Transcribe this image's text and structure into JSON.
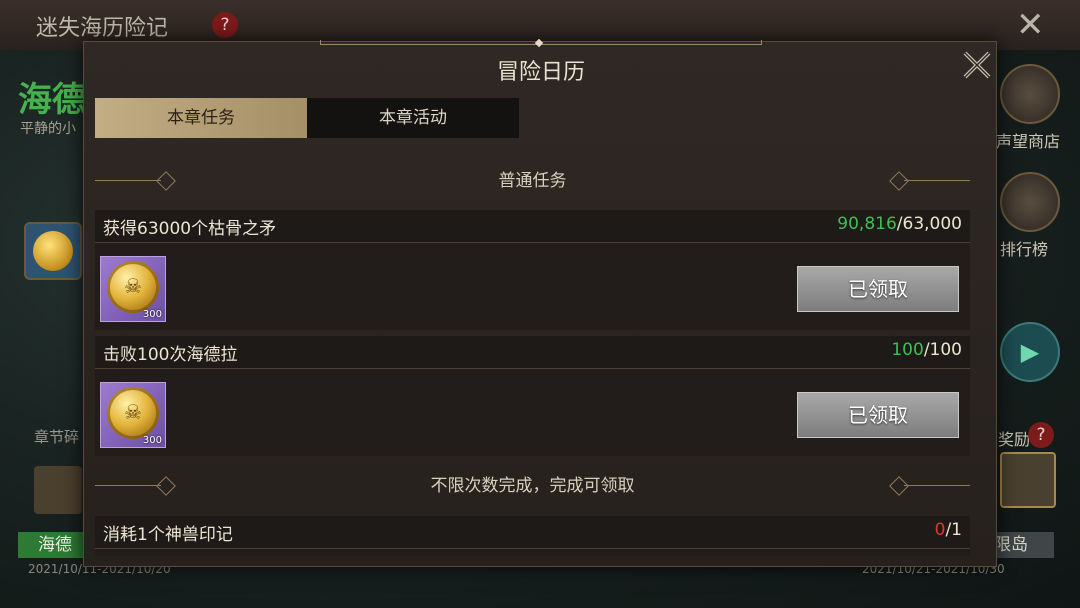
{
  "background": {
    "title": "迷失海历险记",
    "help_glyph": "?",
    "close_glyph": "✕",
    "hero_name": "海德",
    "hero_subtitle": "平静的小",
    "chapter_label": "章节碎",
    "green_bar_text": "海德",
    "date_left": "2021/10/11-2021/10/20",
    "date_right": "2021/10/21-2021/10/30",
    "side_shop_label": "声望商店",
    "side_rank_label": "排行榜",
    "reward_label": "奖励",
    "island_label": "限岛"
  },
  "dialog": {
    "title": "冒险日历",
    "close_icon": "close-icon"
  },
  "tabs": [
    {
      "label": "本章任务",
      "active": true
    },
    {
      "label": "本章活动",
      "active": false
    }
  ],
  "sections": {
    "normal": "普通任务",
    "unlimited": "不限次数完成，完成可领取"
  },
  "tasks": [
    {
      "name": "获得63000个枯骨之矛",
      "progress_current": "90,816",
      "progress_total": "/63,000",
      "reward_qty": "300",
      "reward_icon": "skull-gold-coin-icon",
      "button_label": "已领取"
    },
    {
      "name": "击败100次海德拉",
      "progress_current": "100",
      "progress_total": "/100",
      "reward_qty": "300",
      "reward_icon": "skull-gold-coin-icon",
      "button_label": "已领取"
    },
    {
      "name": "消耗1个神兽印记",
      "progress_current": "0",
      "progress_total": "/1"
    }
  ],
  "colors": {
    "progress_done": "#3fbf52",
    "progress_zero": "#e0352b",
    "tab_active": "#b9a47a"
  }
}
